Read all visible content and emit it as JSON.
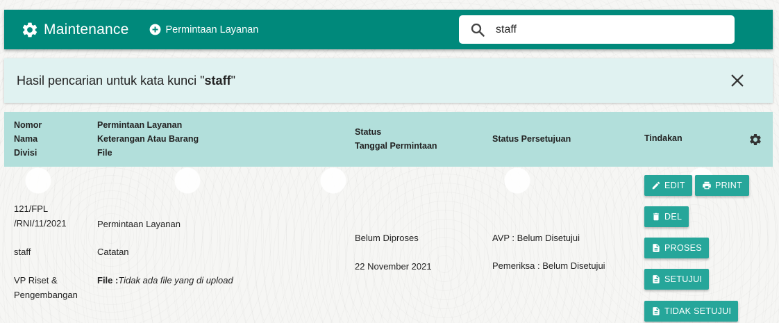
{
  "header": {
    "title": "Maintenance",
    "title_icon": "gear-icon",
    "nav_link_label": "Permintaan Layanan",
    "nav_link_icon": "plus-circle-icon",
    "accent_color": "#00897b"
  },
  "search": {
    "value": "staff",
    "icon": "search-icon"
  },
  "banner": {
    "prefix": "Hasil pencarian untuk kata kunci \"",
    "keyword": "staff",
    "suffix": "\"",
    "close_icon": "close-icon"
  },
  "table": {
    "header_color": "#b2dfdb",
    "columns": {
      "col1": [
        "Nomor",
        "Nama",
        "Divisi"
      ],
      "col2": [
        "Permintaan Layanan",
        "Keterangan Atau Barang",
        "File"
      ],
      "col3": [
        "Status",
        "Tanggal Permintaan"
      ],
      "col4": "Status Persetujuan",
      "col5": "Tindakan"
    },
    "rows": [
      {
        "nomor_line1": "121/FPL",
        "nomor_line2": "/RNI/11/2021",
        "nama": "staff",
        "divisi_line1": "VP Riset &",
        "divisi_line2": "Pengembangan",
        "permintaan": "Permintaan Layanan",
        "keterangan": "Catatan",
        "file_label": "File :",
        "file_value": "Tidak ada file yang di upload",
        "status": "Belum Diproses",
        "tanggal": "22 November 2021",
        "persetujuan_1": "AVP : Belum Disetujui",
        "persetujuan_2": "Pemeriksa : Belum Disetujui",
        "actions": {
          "edit": "EDIT",
          "print": "PRINT",
          "del": "DEL",
          "proses": "PROSES",
          "setujui": "SETUJUI",
          "tidak_setujui": "TIDAK SETUJUI"
        }
      }
    ]
  },
  "button_color": "#26a69a"
}
